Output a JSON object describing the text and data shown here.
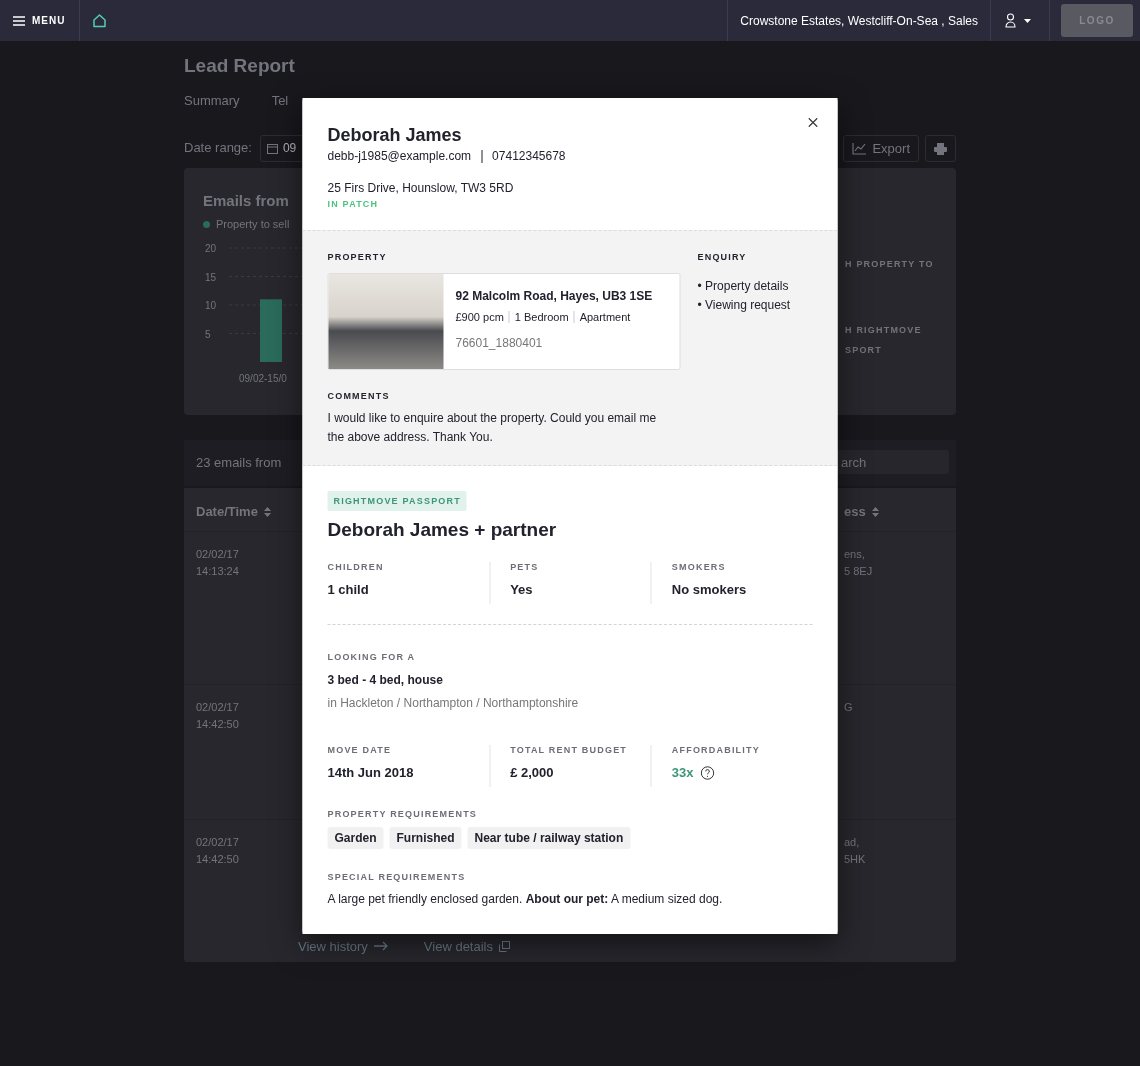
{
  "top_bar": {
    "menu_label": "MENU",
    "account": "Crowstone Estates, Westcliff-On-Sea , Sales",
    "logo": "LOGO"
  },
  "page_title": "Lead Report",
  "tabs": [
    {
      "label": "Summary",
      "selected": false
    },
    {
      "label": "Tel",
      "selected": false
    }
  ],
  "date_range": {
    "label": "Date range:",
    "value": "09"
  },
  "export_label": "Export",
  "emails_card": {
    "title": "Emails from",
    "chart_data": {
      "type": "bar",
      "grid": true,
      "categories": [
        "09/02-15/0"
      ],
      "ylim": [
        0,
        20
      ],
      "yticks": [
        5,
        10,
        15,
        20
      ],
      "series": [
        {
          "name": "Property to sell",
          "color": "#2a6b5b",
          "values": [
            11
          ]
        }
      ]
    },
    "side_texts": [
      [
        "H PROPERTY TO"
      ],
      [
        "H RIGHTMOVE",
        "SPORT"
      ]
    ]
  },
  "emails_table": {
    "summary": "23 emails from",
    "search_placeholder": "arch",
    "columns": [
      {
        "label": "Date/Time"
      },
      {
        "label": "ess"
      }
    ],
    "rows": [
      {
        "date": "02/02/17",
        "time": "14:13:24",
        "address": [
          "ens,",
          "5 8EJ"
        ]
      },
      {
        "date": "02/02/17",
        "time": "14:42:50",
        "address": [
          "G"
        ]
      },
      {
        "date": "02/02/17",
        "time": "14:42:50",
        "address": [
          "ad,",
          "5HK"
        ]
      }
    ],
    "links": [
      {
        "label": "View history",
        "kind": "arrow"
      },
      {
        "label": "View details",
        "kind": "popout"
      }
    ]
  },
  "lead_modal": {
    "name": "Deborah James",
    "email": "debb-j1985@example.com",
    "phone": "07412345678",
    "address": "25 Firs Drive, Hounslow, TW3 5RD",
    "patch_status": "IN PATCH",
    "property": {
      "label": "PROPERTY",
      "address": "92 Malcolm Road, Hayes, UB3 1SE",
      "facts": [
        "£900 pcm",
        "1 Bedroom",
        "Apartment"
      ],
      "reference": "76601_1880401"
    },
    "enquiry": {
      "label": "ENQUIRY",
      "items": [
        "• Property details",
        "• Viewing request"
      ]
    },
    "comments": {
      "label": "COMMENTS",
      "text": "I would like to enquire about the property. Could you email me the above address. Thank You."
    },
    "passport": {
      "badge": "RIGHTMOVE PASSPORT",
      "title": "Deborah James + partner",
      "household": [
        {
          "label": "CHILDREN",
          "value": "1 child"
        },
        {
          "label": "PETS",
          "value": "Yes"
        },
        {
          "label": "SMOKERS",
          "value": "No smokers"
        }
      ],
      "looking_for": {
        "label": "LOOKING FOR A",
        "value": "3 bed - 4 bed, house",
        "area": "in Hackleton / Northampton / Northamptonshire"
      },
      "terms": [
        {
          "label": "MOVE DATE",
          "value": "14th Jun 2018",
          "kind": "plain"
        },
        {
          "label": "TOTAL RENT BUDGET",
          "value": "£ 2,000",
          "kind": "plain"
        },
        {
          "label": "AFFORDABILITY",
          "value": "33x",
          "kind": "score"
        }
      ],
      "requirements": {
        "label": "PROPERTY REQUIREMENTS",
        "tags": [
          "Garden",
          "Furnished",
          "Near tube / railway station"
        ]
      },
      "special": {
        "label": "SPECIAL REQUIREMENTS",
        "text": "A large pet friendly enclosed garden. **About our pet:** A medium sized dog."
      }
    }
  }
}
